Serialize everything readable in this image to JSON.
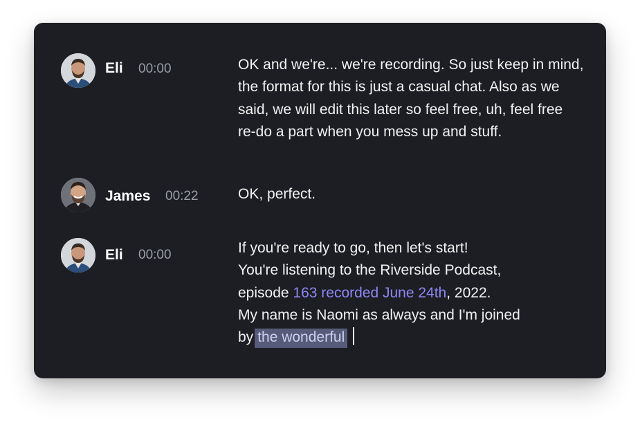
{
  "transcript": {
    "entries": [
      {
        "speaker": "Eli",
        "time": "00:00",
        "text": "OK and we're... we're recording. So just keep in mind, the format for this is just a casual chat. Also as we said, we will edit this later so feel free, uh, feel free re-do a part when you mess up and stuff."
      },
      {
        "speaker": "James",
        "time": "00:22",
        "text": "OK, perfect."
      },
      {
        "speaker": "Eli",
        "time": "00:00",
        "text_parts": {
          "line1": "If you're ready to go, then let's start!",
          "line2": "You're listening to the Riverside Podcast,",
          "line3_before": "episode ",
          "line3_link": "163 recorded June 24th",
          "line3_after": ", 2022.",
          "line4": "My name is Naomi as always and I'm joined",
          "line5_before": "by",
          "line5_selected": "the wonderful"
        }
      }
    ]
  },
  "colors": {
    "card_background": "#1c1e23",
    "link": "#8f86f5",
    "selection": "#555b78",
    "timestamp": "#9a9ea6"
  }
}
